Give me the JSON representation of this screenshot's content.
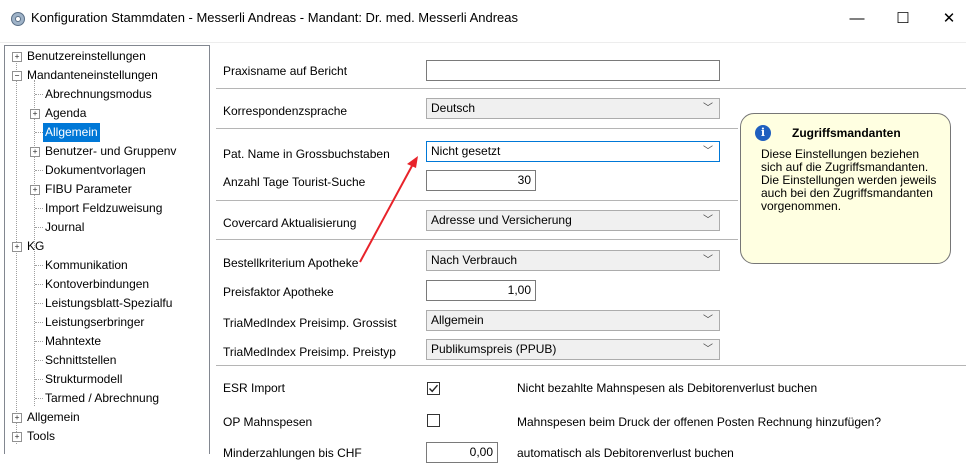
{
  "window": {
    "title": "Konfiguration Stammdaten - Messerli Andreas - Mandant: Dr. med. Messerli Andreas",
    "minimize_glyph": "—",
    "maximize_glyph": "☐",
    "close_glyph": "✕"
  },
  "tree": {
    "items": [
      {
        "label": "Benutzereinstellungen",
        "expander": "+"
      },
      {
        "label": "Mandanteneinstellungen",
        "expander": "−"
      },
      {
        "label": "Abrechnungsmodus"
      },
      {
        "label": "Agenda",
        "expander": "+"
      },
      {
        "label": "Allgemein",
        "selected": true
      },
      {
        "label": "Benutzer- und Gruppenv",
        "expander": "+"
      },
      {
        "label": "Dokumentvorlagen"
      },
      {
        "label": "FIBU Parameter",
        "expander": "+"
      },
      {
        "label": "Import Feldzuweisung"
      },
      {
        "label": "Journal"
      },
      {
        "label": "KG",
        "expander": "+"
      },
      {
        "label": "Kommunikation"
      },
      {
        "label": "Kontoverbindungen"
      },
      {
        "label": "Leistungsblatt-Spezialfu"
      },
      {
        "label": "Leistungserbringer"
      },
      {
        "label": "Mahntexte"
      },
      {
        "label": "Schnittstellen"
      },
      {
        "label": "Strukturmodell"
      },
      {
        "label": "Tarmed / Abrechnung"
      },
      {
        "label": "Allgemein",
        "expander": "+"
      },
      {
        "label": "Tools",
        "expander": "+"
      }
    ]
  },
  "form": {
    "praxisname": {
      "label": "Praxisname auf Bericht",
      "value": ""
    },
    "korrespondenzsprache": {
      "label": "Korrespondenzsprache",
      "value": "Deutsch"
    },
    "pat_name": {
      "label": "Pat. Name in Grossbuchstaben",
      "value": "Nicht gesetzt"
    },
    "tourist": {
      "label": "Anzahl Tage Tourist-Suche",
      "value": "30"
    },
    "covercard": {
      "label": "Covercard Aktualisierung",
      "value": "Adresse und Versicherung"
    },
    "bestellkriterium": {
      "label": "Bestellkriterium Apotheke",
      "value": "Nach Verbrauch"
    },
    "preisfaktor": {
      "label": "Preisfaktor Apotheke",
      "value": "1,00"
    },
    "grossist": {
      "label": "TriaMedIndex Preisimp. Grossist",
      "value": "Allgemein"
    },
    "preistyp": {
      "label": "TriaMedIndex Preisimp. Preistyp",
      "value": "Publikumspreis (PPUB)"
    },
    "esr": {
      "label": "ESR Import",
      "checked": true,
      "desc": "Nicht bezahlte Mahnspesen als Debitorenverlust buchen"
    },
    "op": {
      "label": "OP Mahnspesen",
      "checked": false,
      "desc": "Mahnspesen beim Druck der offenen Posten Rechnung hinzufügen?"
    },
    "minder": {
      "label": "Minderzahlungen bis CHF",
      "value": "0,00",
      "desc": "automatisch als Debitorenverlust buchen"
    }
  },
  "tooltip": {
    "title": "Zugriffsmandanten",
    "body": "Diese Einstellungen beziehen sich auf die Zugriffsmandanten. Die Einstellungen werden jeweils auch bei den Zugriffsmandanten vorgenommen."
  },
  "colors": {
    "selection": "#0078d7",
    "tooltip_bg": "#ffffe1",
    "arrow": "#e8232a"
  }
}
